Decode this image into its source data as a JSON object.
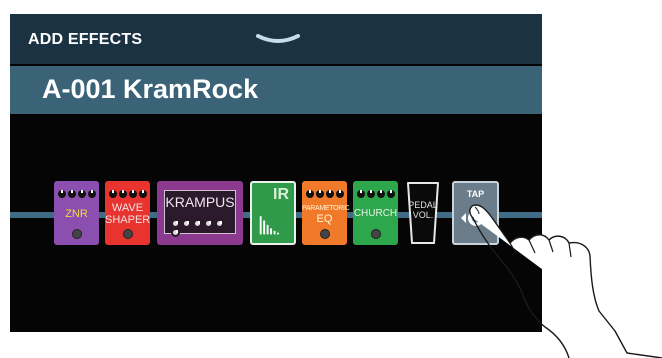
{
  "header": {
    "title": "ADD EFFECTS"
  },
  "patch": {
    "name": "A-001 KramRock"
  },
  "effects": [
    {
      "name": "ZNR",
      "color": "#8b4fb0",
      "knobs": 4
    },
    {
      "name": "WAVE SHAPER",
      "line1": "WAVE",
      "line2": "SHAPER",
      "color": "#e8332f",
      "knobs": 4
    },
    {
      "name": "KRAMPUS",
      "color": "#8b3a8f",
      "knobs": 6
    },
    {
      "name": "IR",
      "color": "#2e9a4a"
    },
    {
      "name": "PARAMETORIC EQ",
      "line1": "PARAMETORIC",
      "line2": "EQ",
      "color": "#f07a2a",
      "knobs": 4
    },
    {
      "name": "CHURCH",
      "color": "#2ea64b",
      "knobs": 4
    },
    {
      "name": "PEDAL VOL.",
      "line1": "PEDAL",
      "line2": "VOL.",
      "color": "#0a0a0a"
    }
  ],
  "tap": {
    "label": "TAP"
  },
  "icons": [
    "chevron-down-icon",
    "tap-circle-icon",
    "finger-pointer-icon",
    "ir-waveform-icon"
  ],
  "colors": {
    "header": "#1a3242",
    "patch_bar": "#3a6378",
    "screen_bg": "#050505",
    "chain_line": "#3f6b86"
  }
}
